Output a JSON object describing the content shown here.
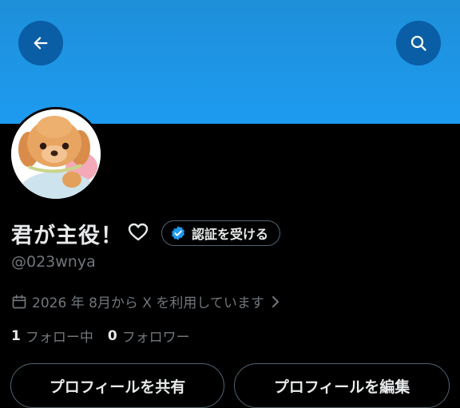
{
  "header": {
    "back_icon": "arrow-left-icon",
    "search_icon": "search-icon",
    "banner_color": "#1d9bf0"
  },
  "profile": {
    "display_name": "君が主役！",
    "name_emoji_icon": "heart-outline-icon",
    "verify_button": "認証を受ける",
    "verify_badge_color": "#1d9bf0",
    "handle": "@023wnya",
    "joined": "2026 年 8月から X を利用しています",
    "following_count": "1",
    "following_label": "フォロー中",
    "followers_count": "0",
    "followers_label": "フォロワー"
  },
  "actions": {
    "share_label": "プロフィールを共有",
    "edit_label": "プロフィールを編集"
  }
}
